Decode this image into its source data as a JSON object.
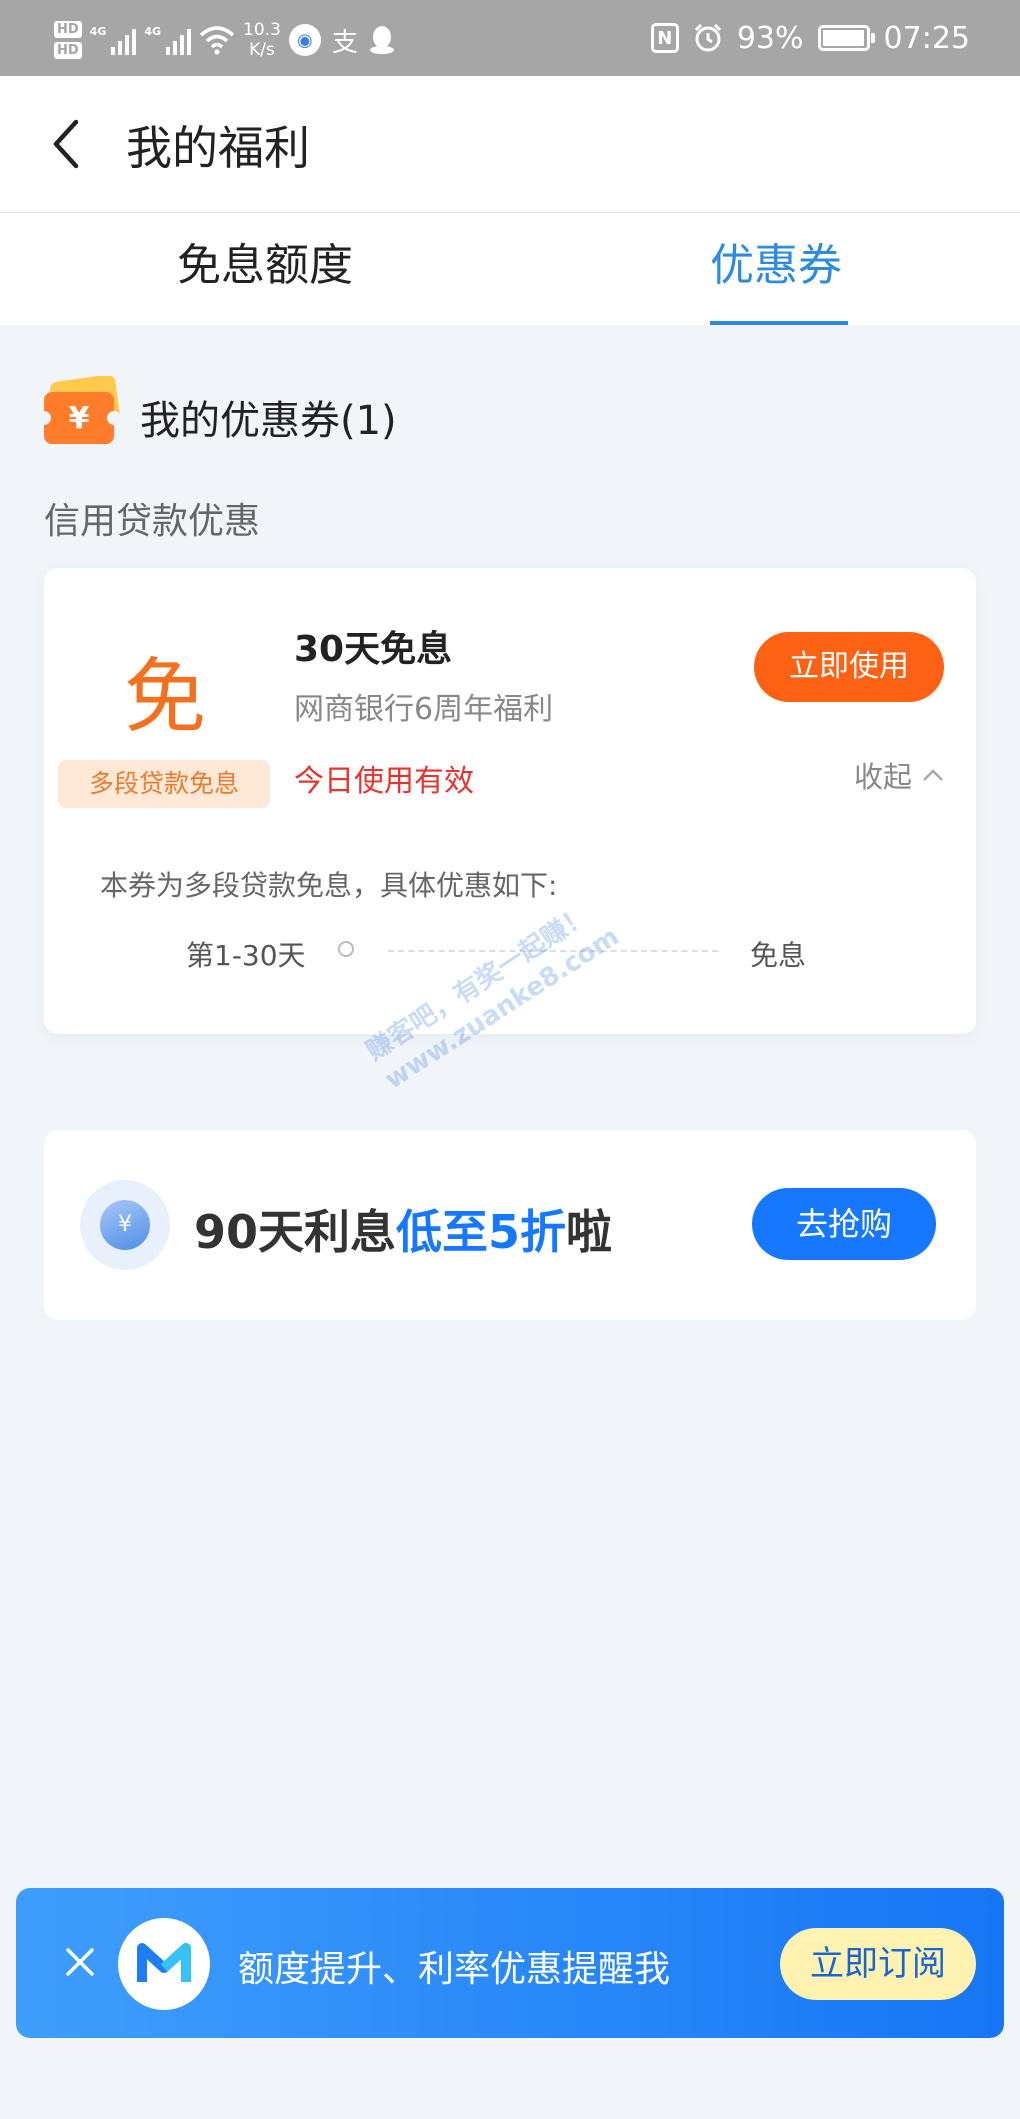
{
  "status_bar": {
    "hd1": "HD",
    "hd2": "HD",
    "net1": "4G",
    "net2": "4G",
    "speed_value": "10.3",
    "speed_unit": "K/s",
    "nfc": "N",
    "battery": "93%",
    "time": "07:25"
  },
  "header": {
    "title": "我的福利"
  },
  "tabs": [
    {
      "label": "免息额度",
      "active": false
    },
    {
      "label": "优惠券",
      "active": true
    }
  ],
  "coupons_section": {
    "title": "我的优惠券(1)",
    "category": "信用贷款优惠"
  },
  "coupon": {
    "badge_char": "免",
    "tag": "多段贷款免息",
    "title": "30天免息",
    "description": "网商银行6周年福利",
    "validity": "今日使用有效",
    "use_button": "立即使用",
    "collapse_label": "收起",
    "detail_note": "本券为多段贷款免息，具体优惠如下:",
    "schedule": [
      {
        "period": "第1-30天",
        "benefit": "免息"
      }
    ]
  },
  "promo": {
    "text_prefix": "90天利息",
    "text_highlight": "低至5折",
    "text_suffix": "啦",
    "button": "去抢购"
  },
  "watermark": {
    "line1": "赚客吧，有奖一起赚！",
    "line2": "www.zuanke8.com"
  },
  "banner": {
    "text": "额度提升、利率优惠提醒我",
    "button": "立即订阅"
  },
  "colors": {
    "accent_blue": "#1677ff",
    "tab_active": "#2c8be0",
    "orange_button": "#fd6114",
    "valid_red": "#e8332d",
    "background": "#f1f4f9"
  }
}
